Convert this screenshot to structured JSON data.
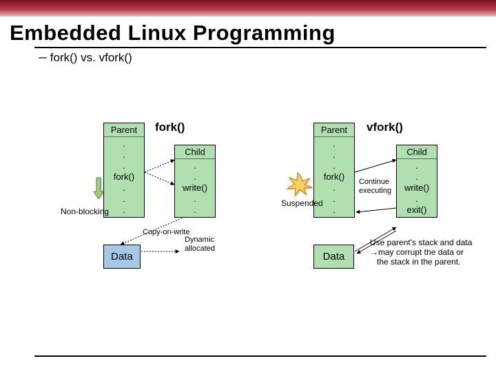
{
  "title": "Embedded Linux Programming",
  "subtitle": "─ fork() vs. vfork()",
  "left": {
    "title": "fork()",
    "parent": {
      "head": "Parent",
      "body": [
        ".",
        ".",
        ".",
        "fork()",
        ".",
        ".",
        "."
      ]
    },
    "child": {
      "head": "Child",
      "body": [
        ".",
        ".",
        "write()",
        ".",
        "."
      ]
    },
    "data_label": "Data",
    "nonblocking": "Non-blocking",
    "cow": "Copy-on-write",
    "dyn": "Dynamic\nallocated"
  },
  "right": {
    "title": "vfork()",
    "parent": {
      "head": "Parent",
      "body": [
        ".",
        ".",
        ".",
        "fork()",
        ".",
        ".",
        "."
      ]
    },
    "child": {
      "head": "Child",
      "body": [
        ".",
        ".",
        "write()",
        ".",
        "exit()"
      ]
    },
    "continue": "Continue\nexecuting",
    "suspended": "Suspended",
    "data_label": "Data",
    "warn": "Use parent's stack and data\n→may corrupt the data or\n   the stack in the parent."
  }
}
